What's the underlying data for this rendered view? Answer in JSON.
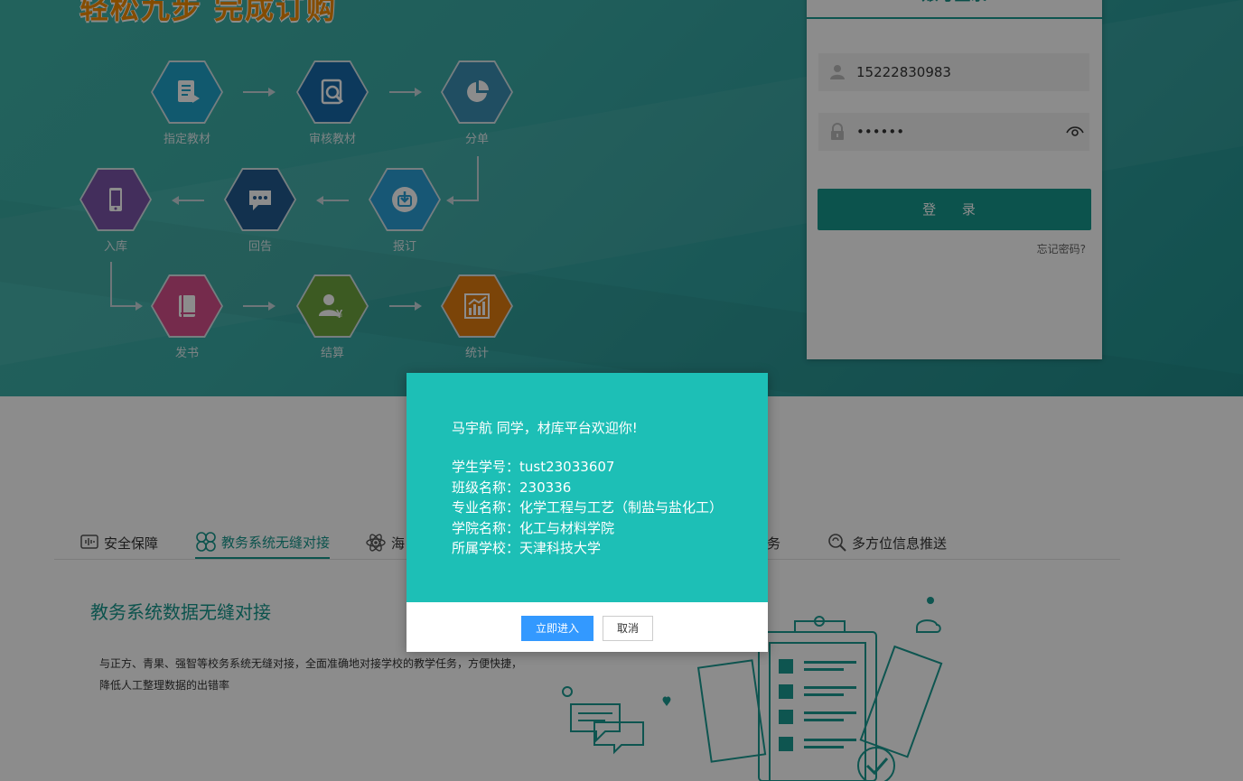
{
  "hero": {
    "title": "轻松九步 完成订购",
    "steps": [
      {
        "label": "指定教材",
        "color": "#1fa3c9"
      },
      {
        "label": "审核教材",
        "color": "#1668a8"
      },
      {
        "label": "分单",
        "color": "#3b8fb3"
      },
      {
        "label": "报订",
        "color": "#2a9fd6"
      },
      {
        "label": "回告",
        "color": "#21598f"
      },
      {
        "label": "入库",
        "color": "#7a55a8"
      },
      {
        "label": "发书",
        "color": "#d64f8a"
      },
      {
        "label": "结算",
        "color": "#6ea53f"
      },
      {
        "label": "统计",
        "color": "#e07d10"
      }
    ]
  },
  "login": {
    "title": "账号登录",
    "username": "15222830983",
    "password": "••••••",
    "submit_label": "登 录",
    "forgot_label": "忘记密码?"
  },
  "tabs": [
    {
      "label": "安全保障",
      "icon": "shield-sound-icon"
    },
    {
      "label": "教务系统无缝对接",
      "icon": "clover-icon",
      "active": true
    },
    {
      "label": "海",
      "icon": "atom-icon"
    },
    {
      "label": "务",
      "icon": ""
    },
    {
      "label": "多方位信息推送",
      "icon": "search-refresh-icon"
    }
  ],
  "section": {
    "title": "教务系统数据无缝对接",
    "desc_line1": "与正方、青果、强智等校务系统无缝对接，全面准确地对接学校的教学任务，方便快捷，",
    "desc_line2": "降低人工整理数据的出错率"
  },
  "modal": {
    "welcome": "马宇航 同学，材库平台欢迎你!",
    "rows": [
      {
        "label": "学生学号：",
        "value": "tust23033607"
      },
      {
        "label": "班级名称：",
        "value": "230336"
      },
      {
        "label": "专业名称：",
        "value": "化学工程与工艺（制盐与盐化工）"
      },
      {
        "label": "学院名称：",
        "value": "化工与材料学院"
      },
      {
        "label": "所属学校：",
        "value": "天津科技大学"
      }
    ],
    "confirm_label": "立即进入",
    "cancel_label": "取消"
  },
  "colors": {
    "accent": "#16978d",
    "modal_bg": "#1dbfb6",
    "primary_button": "#3399ff",
    "title_orange": "#f08a00"
  }
}
